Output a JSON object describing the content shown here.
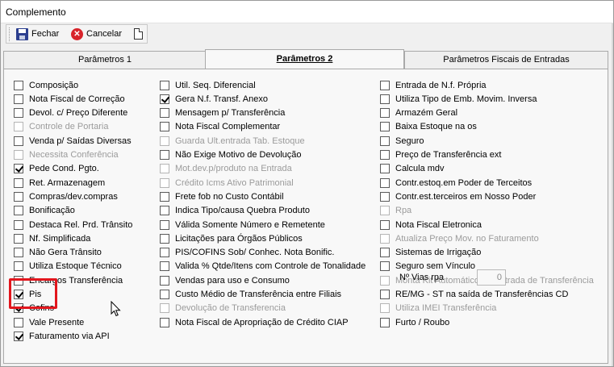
{
  "window": {
    "title": "Complemento"
  },
  "toolbar": {
    "fechar": "Fechar",
    "cancelar": "Cancelar"
  },
  "tabs": [
    "Parâmetros 1",
    "Parâmetros 2",
    "Parâmetros Fiscais de Entradas"
  ],
  "active_tab": "Parâmetros 2",
  "col1": [
    {
      "label": "Composição",
      "checked": false,
      "enabled": true
    },
    {
      "label": "Nota Fiscal de Correção",
      "checked": false,
      "enabled": true
    },
    {
      "label": "Devol. c/ Preço Diferente",
      "checked": false,
      "enabled": true
    },
    {
      "label": "Controle de Portaria",
      "checked": false,
      "enabled": false
    },
    {
      "label": "Venda p/ Saídas Diversas",
      "checked": false,
      "enabled": true
    },
    {
      "label": "Necessita Conferência",
      "checked": false,
      "enabled": false
    },
    {
      "label": "Pede Cond. Pgto.",
      "checked": true,
      "enabled": true
    },
    {
      "label": "Ret. Armazenagem",
      "checked": false,
      "enabled": true
    },
    {
      "label": "Compras/dev.compras",
      "checked": false,
      "enabled": true
    },
    {
      "label": "Bonificação",
      "checked": false,
      "enabled": true
    },
    {
      "label": "Destaca Rel. Prd. Trânsito",
      "checked": false,
      "enabled": true
    },
    {
      "label": "Nf. Simplificada",
      "checked": false,
      "enabled": true
    },
    {
      "label": "Não Gera Trânsito",
      "checked": false,
      "enabled": true
    },
    {
      "label": "Utiliza Estoque Técnico",
      "checked": false,
      "enabled": true
    },
    {
      "label": "Encargos Transferência",
      "checked": false,
      "enabled": true
    },
    {
      "label": "Pis",
      "checked": true,
      "enabled": true
    },
    {
      "label": "Cofins",
      "checked": true,
      "enabled": true
    },
    {
      "label": "Vale Presente",
      "checked": false,
      "enabled": true
    },
    {
      "label": "Faturamento via API",
      "checked": true,
      "enabled": true
    }
  ],
  "col2": [
    {
      "label": "Util. Seq. Diferencial",
      "checked": false,
      "enabled": true
    },
    {
      "label": "Gera N.f. Transf. Anexo",
      "checked": true,
      "enabled": true
    },
    {
      "label": "Mensagem p/ Transferência",
      "checked": false,
      "enabled": true
    },
    {
      "label": "Nota Fiscal Complementar",
      "checked": false,
      "enabled": true
    },
    {
      "label": "Guarda Ult.entrada Tab. Estoque",
      "checked": false,
      "enabled": false
    },
    {
      "label": "Não Exige Motivo de Devolução",
      "checked": false,
      "enabled": true
    },
    {
      "label": "Mot.dev.p/produto na Entrada",
      "checked": false,
      "enabled": false
    },
    {
      "label": "Crédito Icms Ativo Patrimonial",
      "checked": false,
      "enabled": false
    },
    {
      "label": "Frete fob no Custo Contábil",
      "checked": false,
      "enabled": true
    },
    {
      "label": "Indica Tipo/causa Quebra Produto",
      "checked": false,
      "enabled": true
    },
    {
      "label": "Válida Somente Número e Remetente",
      "checked": false,
      "enabled": true
    },
    {
      "label": "Licitações para Órgãos Públicos",
      "checked": false,
      "enabled": true
    },
    {
      "label": "PIS/COFINS Sob/ Conhec. Nota Bonific.",
      "checked": false,
      "enabled": true
    },
    {
      "label": "Valida % Qtde/Itens com Controle de Tonalidade",
      "checked": false,
      "enabled": true
    },
    {
      "label": "Vendas para uso e Consumo",
      "checked": false,
      "enabled": true
    },
    {
      "label": "Custo Médio de Transferência entre Filiais",
      "checked": false,
      "enabled": true
    },
    {
      "label": "Devolução de Transferencia",
      "checked": false,
      "enabled": false
    },
    {
      "label": "Nota Fiscal de Apropriação de Crédito CIAP",
      "checked": false,
      "enabled": true
    }
  ],
  "col3": [
    {
      "label": "Entrada de N.f. Própria",
      "checked": false,
      "enabled": true
    },
    {
      "label": "Utiliza Tipo de Emb. Movim. Inversa",
      "checked": false,
      "enabled": true
    },
    {
      "label": "Armazém Geral",
      "checked": false,
      "enabled": true
    },
    {
      "label": "Baixa Estoque na os",
      "checked": false,
      "enabled": true
    },
    {
      "label": "Seguro",
      "checked": false,
      "enabled": true
    },
    {
      "label": "Preço de Transferência ext",
      "checked": false,
      "enabled": true
    },
    {
      "label": "Calcula mdv",
      "checked": false,
      "enabled": true
    },
    {
      "label": "Contr.estoq.em Poder de Terceitos",
      "checked": false,
      "enabled": true
    },
    {
      "label": "Contr.est.terceiros em Nosso Poder",
      "checked": false,
      "enabled": true
    },
    {
      "label": "Rpa",
      "checked": false,
      "enabled": false
    },
    {
      "label": "Nota Fiscal Eletronica",
      "checked": false,
      "enabled": true
    },
    {
      "label": "Atualiza Preço Mov. no Faturamento",
      "checked": false,
      "enabled": false
    },
    {
      "label": "Sistemas de Irrigação",
      "checked": false,
      "enabled": true
    },
    {
      "label": "Seguro sem Vínculo",
      "checked": false,
      "enabled": true
    },
    {
      "label": "Monta Kit Automático na Entrada de Transferência",
      "checked": false,
      "enabled": false
    },
    {
      "label": "RE/MG - ST na saída de Transferências CD",
      "checked": false,
      "enabled": true
    },
    {
      "label": "Utiliza IMEI Transferência",
      "checked": false,
      "enabled": false
    },
    {
      "label": "Furto / Roubo",
      "checked": false,
      "enabled": true
    }
  ],
  "rpa": {
    "label": "Nº Vias rpa",
    "value": "0"
  }
}
